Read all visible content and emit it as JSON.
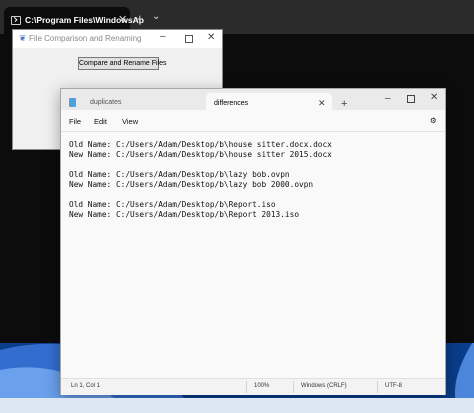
{
  "terminal": {
    "tab_title": "C:\\Program Files\\WindowsAp",
    "close_glyph": "✕",
    "new_tab_glyph": "+",
    "dropdown_glyph": "⌄"
  },
  "tk_window": {
    "title": "File Comparison and Renaming",
    "button_label": "Compare and Rename Files",
    "min_glyph": "–",
    "close_glyph": "✕"
  },
  "notepad": {
    "tabs": [
      {
        "label": "duplicates"
      },
      {
        "label": "differences"
      }
    ],
    "tab_close_glyph": "✕",
    "new_tab_glyph": "+",
    "min_glyph": "–",
    "close_glyph": "✕",
    "menu": [
      "File",
      "Edit",
      "View"
    ],
    "lines": [
      "Old Name: C:/Users/Adam/Desktop/b\\house sitter.docx.docx",
      "New Name: C:/Users/Adam/Desktop/b\\house sitter 2015.docx",
      "",
      "Old Name: C:/Users/Adam/Desktop/b\\lazy bob.ovpn",
      "New Name: C:/Users/Adam/Desktop/b\\lazy bob 2000.ovpn",
      "",
      "Old Name: C:/Users/Adam/Desktop/b\\Report.iso",
      "New Name: C:/Users/Adam/Desktop/b\\Report 2013.iso"
    ],
    "status": {
      "position": "Ln 1, Col 1",
      "zoom": "100%",
      "line_ending": "Windows (CRLF)",
      "encoding": "UTF-8"
    }
  },
  "icons": [
    "terminal-icon",
    "feather-icon",
    "notepad-file-icon",
    "settings-gear-icon"
  ]
}
